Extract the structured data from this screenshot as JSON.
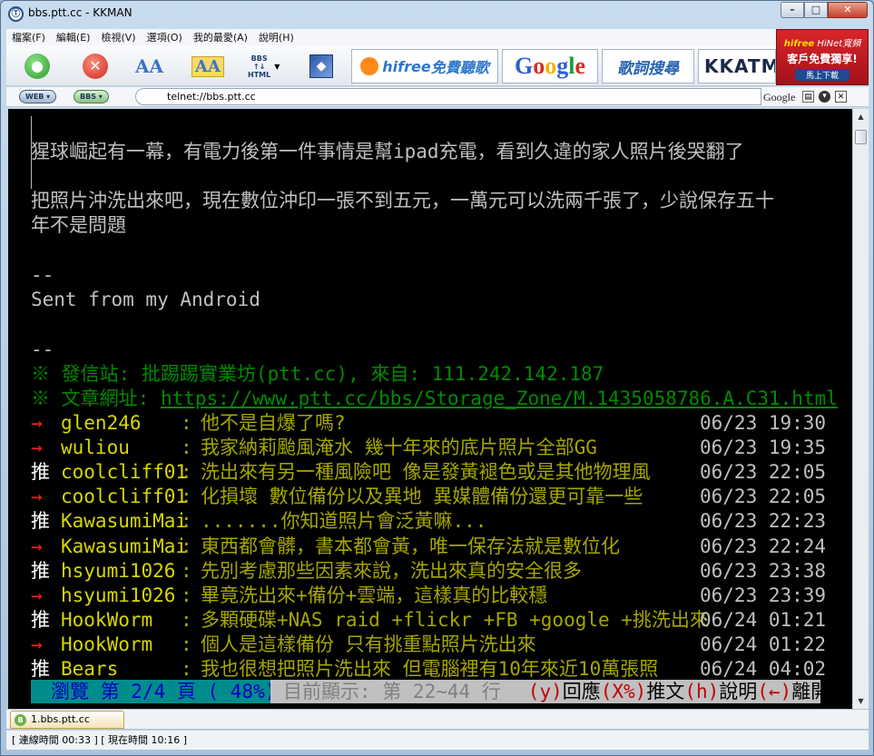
{
  "window": {
    "title": "bbs.ptt.cc - KKMAN",
    "icon": "kkman-logo-icon",
    "icon_glyph": "Ⓣ"
  },
  "menu": [
    "檔案(F)",
    "編輯(E)",
    "檢視(V)",
    "選項(O)",
    "我的最愛(A)",
    "說明(H)"
  ],
  "toolbar": {
    "go_icon": "go-icon",
    "stop_icon": "stop-icon",
    "font_small": "AA",
    "font_large": "AA",
    "bbs_html_l1": "BBS",
    "bbs_html_l2": "↑↓",
    "bbs_html_l3": "HTML",
    "ads": {
      "hifree_brand": "hifree",
      "hifree_cn": "免費聽歌",
      "google": "Google",
      "dict": "歌詞搜尋",
      "kkatm": "KKATM"
    }
  },
  "hinet_ad": {
    "brand": "hifree",
    "line1": "HiNet寬頻",
    "line2": "客戶免費獨享!",
    "line3": "馬上下載"
  },
  "address": {
    "web_label": "WEB",
    "bbs_label": "BBS",
    "url": "telnet://bbs.ptt.cc",
    "search_label": "Google"
  },
  "terminal": {
    "lines": [
      "猩球崛起有一幕，有電力後第一件事情是幫ipad充電，看到久違的家人照片後哭翻了",
      "把照片沖洗出來吧，現在數位沖印一張不到五元，一萬元可以洗兩千張了，少說保存五十",
      "年不是問題",
      "--",
      "Sent from my Android",
      "--"
    ],
    "from_line": "※ 發信站: 批踢踢實業坊(ptt.cc), 來自: 111.242.142.187",
    "url_prefix": "※ 文章網址: ",
    "url": "https://www.ptt.cc/bbs/Storage_Zone/M.1435058786.A.C31.html",
    "pushes": [
      {
        "tag": "→",
        "user": "glen246",
        "msg": "他不是自爆了嗎?",
        "time": "06/23 19:30"
      },
      {
        "tag": "→",
        "user": "wuliou",
        "msg": "我家納莉颱風淹水 幾十年來的底片照片全部GG",
        "time": "06/23 19:35"
      },
      {
        "tag": "推",
        "user": "coolcliff01",
        "msg": "洗出來有另一種風險吧 像是發黃褪色或是其他物理風",
        "time": "06/23 22:05"
      },
      {
        "tag": "→",
        "user": "coolcliff01",
        "msg": "化損壞 數位備份以及異地 異媒體備份還更可靠一些",
        "time": "06/23 22:05"
      },
      {
        "tag": "推",
        "user": "KawasumiMai",
        "msg": ".......你知道照片會泛黃嘛...",
        "time": "06/23 22:23"
      },
      {
        "tag": "→",
        "user": "KawasumiMai",
        "msg": "東西都會髒，書本都會黃，唯一保存法就是數位化",
        "time": "06/23 22:24"
      },
      {
        "tag": "推",
        "user": "hsyumi1026",
        "msg": "先別考慮那些因素來說，洗出來真的安全很多",
        "time": "06/23 23:38"
      },
      {
        "tag": "→",
        "user": "hsyumi1026",
        "msg": "畢竟洗出來+備份+雲端，這樣真的比較穩",
        "time": "06/23 23:39"
      },
      {
        "tag": "推",
        "user": "HookWorm",
        "msg": "多顆硬碟+NAS raid +flickr +FB +google +挑洗出來",
        "time": "06/24 01:21"
      },
      {
        "tag": "→",
        "user": "HookWorm",
        "msg": "個人是這樣備份  只有挑重點照片洗出來",
        "time": "06/24 01:22"
      },
      {
        "tag": "推",
        "user": "Bears",
        "msg": "我也很想把照片洗出來 但電腦裡有10年來近10萬張照",
        "time": "06/24 04:02"
      }
    ],
    "status": {
      "browse": "瀏覽 第 2/4 頁 ( 48%)",
      "range": "目前顯示: 第 22~44 行",
      "k1": "(y)",
      "t1": "回應",
      "k2": "(X%)",
      "t2": "推文",
      "k3": "(h)",
      "t3": "說明",
      "k4": "(←)",
      "t4": "離開",
      "progress_percent": 48
    }
  },
  "tab": {
    "label": "1.bbs.ptt.cc",
    "icon_glyph": "B"
  },
  "statusbar": "[ 連線時間 00:33 ] [ 現在時間 10:16 ]",
  "colors": {
    "terminal_bg": "#000000",
    "signature_green": "#008c00",
    "arrow_red": "#ff1c1c",
    "user_yellow": "#d7d700",
    "push_text": "#a6a600",
    "status_cyan": "#008c8c"
  }
}
